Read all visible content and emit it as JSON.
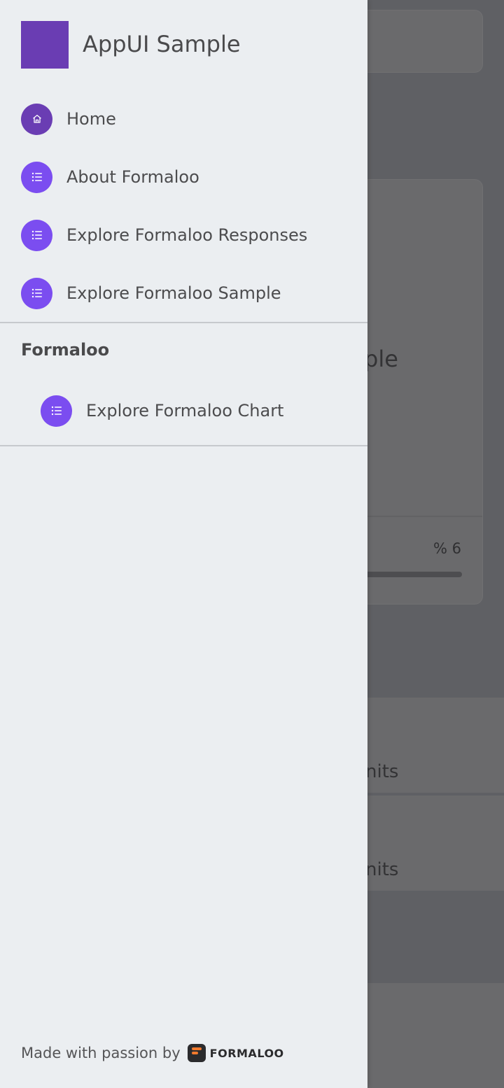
{
  "app": {
    "title": "AppUI Sample"
  },
  "drawer": {
    "items": [
      {
        "label": "Home",
        "icon": "home-icon"
      },
      {
        "label": "About Formaloo",
        "icon": "list-icon"
      },
      {
        "label": "Explore Formaloo Responses",
        "icon": "list-icon"
      },
      {
        "label": "Explore Formaloo Sample",
        "icon": "list-icon"
      }
    ],
    "section": {
      "title": "Formaloo",
      "items": [
        {
          "label": "Explore Formaloo Chart",
          "icon": "list-icon"
        }
      ]
    },
    "footer": {
      "made_with": "Made with passion by",
      "brand": "FORMALOO"
    }
  },
  "background": {
    "dot_text": ".",
    "big_text": "ple",
    "percent": "% 6",
    "panel1_text": "nits",
    "panel2_text": "nits"
  },
  "colors": {
    "accent": "#7b4df0",
    "brand": "#6a3db3",
    "drawer_bg": "#ebeef1",
    "scrim": "#5f6064"
  }
}
